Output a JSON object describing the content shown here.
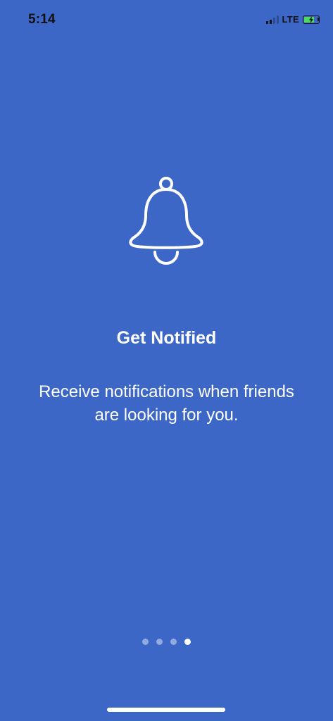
{
  "status_bar": {
    "time": "5:14",
    "network": "LTE",
    "signal_bars_active": 2,
    "signal_bars_total": 4,
    "battery_level": 0.75,
    "battery_charging": true
  },
  "colors": {
    "background": "#3C67C7",
    "battery_fill": "#4CD964",
    "text": "#FFFFFF"
  },
  "onboarding": {
    "icon": "bell-icon",
    "title": "Get Notified",
    "description": "Receive notifications when friends are looking for you."
  },
  "pagination": {
    "total_pages": 4,
    "current_page": 4
  }
}
